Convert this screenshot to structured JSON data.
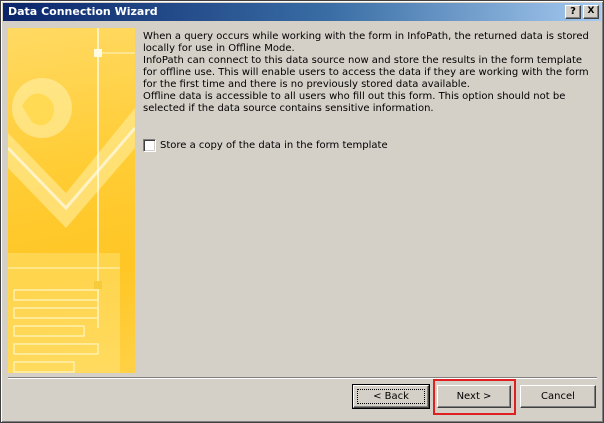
{
  "window": {
    "title": "Data Connection Wizard",
    "help_button": "?",
    "close_button": "X"
  },
  "content": {
    "paragraph1": "When a query occurs while working with the form in InfoPath, the returned data is stored locally for use in Offline Mode.",
    "paragraph2": "InfoPath can connect to this data source now and store the results in the form template for offline use. This will enable users to access the data if they are working with the form for the first time and there is no previously stored data available.",
    "paragraph3": "Offline data is accessible to all users who fill out this form. This option should not be selected if the data source contains sensitive information.",
    "checkbox_label": "Store a copy of the data in the form template",
    "checkbox_checked": false
  },
  "buttons": {
    "back": "< Back",
    "next": "Next >",
    "cancel": "Cancel"
  },
  "colors": {
    "title_gradient_start": "#0a246a",
    "title_gradient_end": "#a6caf0",
    "banner_yellow": "#ffcc33",
    "highlight_red": "#e02020"
  }
}
